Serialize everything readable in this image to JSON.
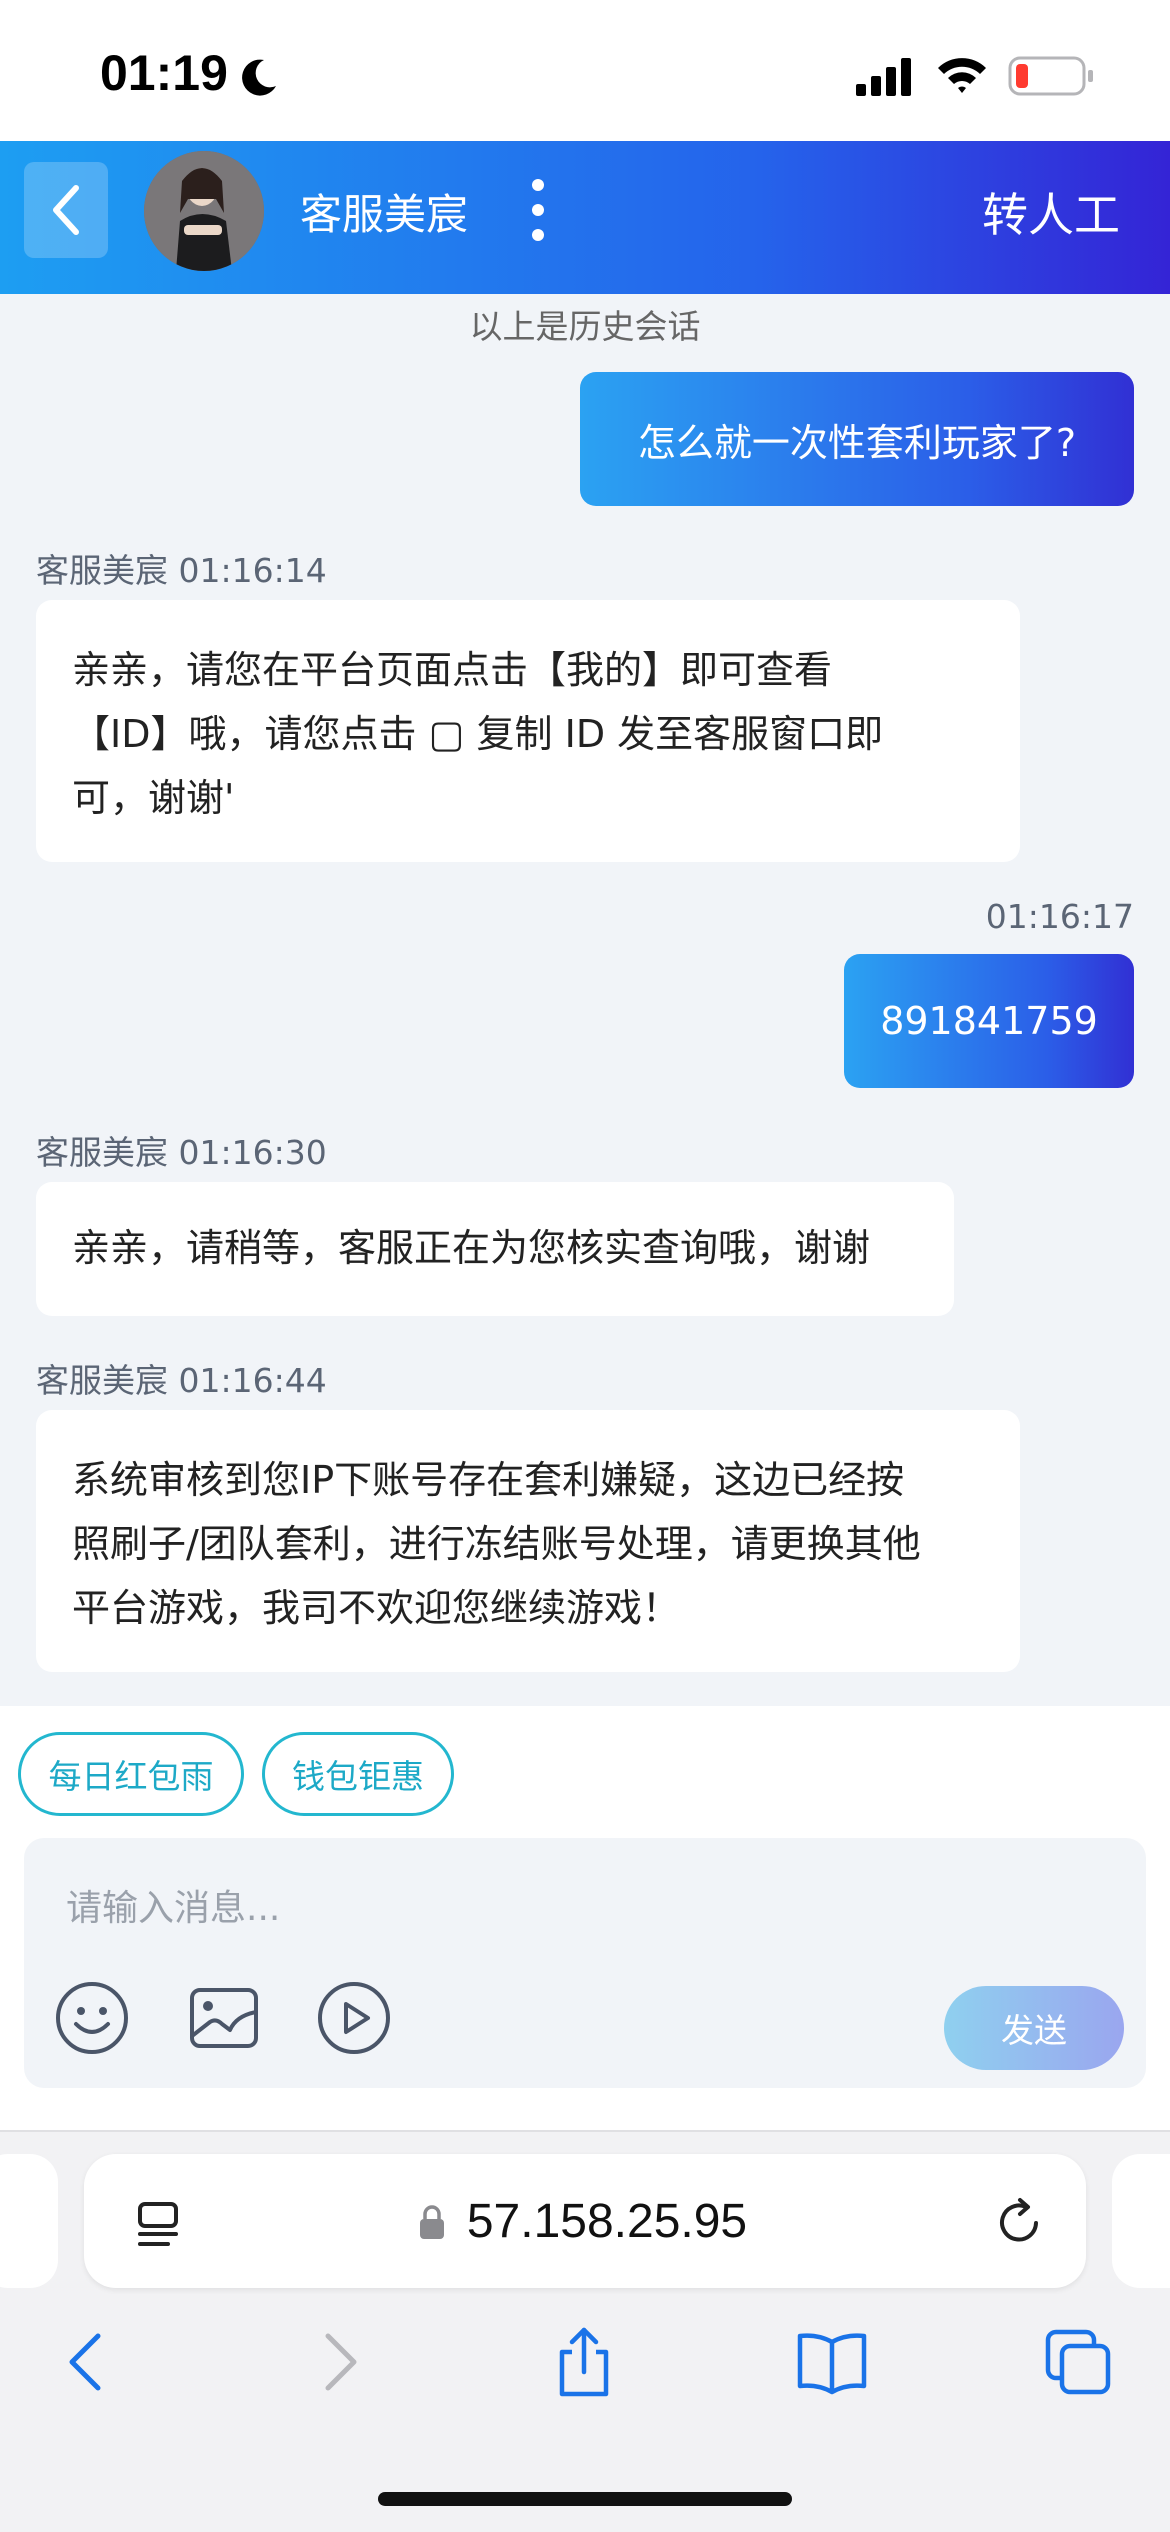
{
  "status_bar": {
    "time": "01:19",
    "icons": [
      "moon-icon",
      "signal-icon",
      "wifi-icon",
      "battery-icon"
    ],
    "battery_level": 0.1
  },
  "header": {
    "agent_name": "客服美宸",
    "transfer_label": "转人工"
  },
  "chat": {
    "history_note": "以上是历史会话",
    "messages": [
      {
        "side": "right",
        "time": "",
        "text": "怎么就一次性套利玩家了?"
      },
      {
        "side": "left",
        "sender": "客服美宸",
        "time": "01:16:14",
        "lines": [
          "亲亲，请您在平台页面点击【我的】即可查看",
          "【ID】哦，请您点击 ▢ 复制 ID 发至客服窗口即",
          "可，谢谢'"
        ]
      },
      {
        "side": "right",
        "time": "01:16:17",
        "text": "891841759"
      },
      {
        "side": "left",
        "sender": "客服美宸",
        "time": "01:16:30",
        "lines": [
          "亲亲，请稍等，客服正在为您核实查询哦，谢谢"
        ]
      },
      {
        "side": "left",
        "sender": "客服美宸",
        "time": "01:16:44",
        "lines": [
          "系统审核到您IP下账号存在套利嫌疑，这边已经按",
          "照刷子/团队套利，进行冻结账号处理，请更换其他",
          "平台游戏，我司不欢迎您继续游戏！"
        ]
      }
    ]
  },
  "quick_replies": [
    "每日红包雨",
    "钱包钜惠"
  ],
  "composer": {
    "placeholder": "请输入消息...",
    "send_label": "发送",
    "tools": [
      "emoji-icon",
      "image-icon",
      "video-icon"
    ]
  },
  "browser": {
    "url": "57.158.25.95"
  },
  "colors": {
    "header_start": "#1d9ef2",
    "header_end": "#3424d6",
    "chip_border": "#23b7cf",
    "background": "#f1f4f8"
  }
}
